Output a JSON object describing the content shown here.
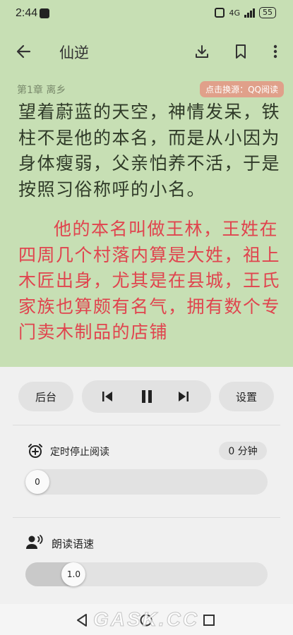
{
  "status": {
    "time": "2:44",
    "network": "4G",
    "battery": "55"
  },
  "appbar": {
    "title": "仙逆",
    "back_icon": "back-arrow-icon",
    "download_icon": "download-icon",
    "bookmark_icon": "bookmark-icon",
    "more_icon": "more-vertical-icon"
  },
  "chapter": {
    "label": "第1章 离乡",
    "source_button": "点击换源：QQ阅读"
  },
  "content": {
    "paragraph1": "望着蔚蓝的天空，神情发呆，铁柱不是他的本名，而是从小因为身体瘦弱，父亲怕养不活，于是按照习俗称呼的小名。",
    "paragraph2": "他的本名叫做王林，王姓在四周几个村落内算是大姓，祖上木匠出身，尤其是在县城，王氏家族也算颇有名气，拥有数个专门卖木制品的店铺"
  },
  "controls": {
    "background_button": "后台",
    "settings_button": "设置"
  },
  "timer": {
    "label": "定时停止阅读",
    "value_text": "0 分钟",
    "slider_value": "0",
    "slider_fraction": 0
  },
  "speed": {
    "label": "朗读语速",
    "slider_value": "1.0",
    "slider_fraction": 0.15
  },
  "watermark": "GASK.CC",
  "colors": {
    "reader_bg": "#c7dfb4",
    "highlight_text": "#e0444e",
    "panel_bg": "#f0f0f0"
  }
}
